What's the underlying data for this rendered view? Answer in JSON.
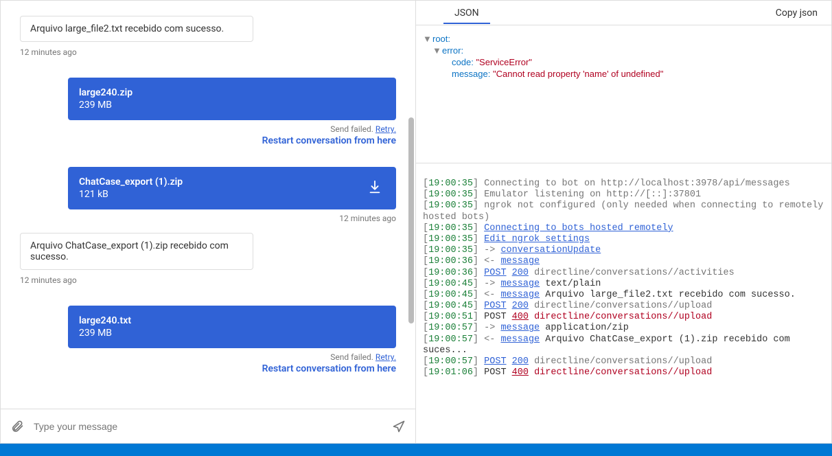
{
  "chat": {
    "messages": [
      {
        "from": "bot",
        "text": "Arquivo large_file2.txt recebido com sucesso.",
        "timestamp": "12 minutes ago"
      },
      {
        "from": "user",
        "attachment_name": "large240.zip",
        "attachment_size": "239 MB",
        "send_failed_label": "Send failed.",
        "retry_label": "Retry.",
        "restart_label": "Restart conversation from here"
      },
      {
        "from": "user",
        "attachment_name": "ChatCase_export (1).zip",
        "attachment_size": "121 kB",
        "has_download": true,
        "timestamp": "12 minutes ago"
      },
      {
        "from": "bot",
        "text": "Arquivo ChatCase_export (1).zip recebido com sucesso.",
        "timestamp": "12 minutes ago"
      },
      {
        "from": "user",
        "attachment_name": "large240.txt",
        "attachment_size": "239 MB",
        "send_failed_label": "Send failed.",
        "retry_label": "Retry.",
        "restart_label": "Restart conversation from here"
      }
    ],
    "composer_placeholder": "Type your message"
  },
  "right": {
    "tab_json_label": "JSON",
    "copy_json_label": "Copy json",
    "json_tree": {
      "root_label": "root:",
      "error_label": "error:",
      "code_label": "code:",
      "code_value": "\"ServiceError\"",
      "message_label": "message:",
      "message_value": "\"Cannot read property 'name' of undefined\""
    },
    "log": [
      {
        "ts": "19:00:35",
        "text": "Connecting to bot on http://localhost:3978/api/messages",
        "style": "dim"
      },
      {
        "ts": "19:00:35",
        "text": "Emulator listening on http://[::]:37801",
        "style": "dim"
      },
      {
        "ts": "19:00:35",
        "text": "ngrok not configured (only needed when connecting to remotely hosted bots)",
        "style": "dim"
      },
      {
        "ts": "19:00:35",
        "link": "Connecting to bots hosted remotely"
      },
      {
        "ts": "19:00:35",
        "link": "Edit ngrok settings"
      },
      {
        "ts": "19:00:35",
        "arrow": "->",
        "link": "conversationUpdate"
      },
      {
        "ts": "19:00:36",
        "arrow": "<-",
        "link": "message"
      },
      {
        "ts": "19:00:36",
        "method": "POST",
        "code": "200",
        "code_ok": true,
        "path": "directline/conversations/<conversationId>/activities",
        "path_style": "dim"
      },
      {
        "ts": "19:00:45",
        "arrow": "->",
        "link": "message",
        "suffix": "text/plain"
      },
      {
        "ts": "19:00:45",
        "arrow": "<-",
        "link": "message",
        "suffix": "Arquivo large_file2.txt recebido com sucesso."
      },
      {
        "ts": "19:00:45",
        "method": "POST",
        "code": "200",
        "code_ok": true,
        "path": "directline/conversations/<conversationId>/upload",
        "path_style": "dim"
      },
      {
        "ts": "19:00:51",
        "method": "POST",
        "code": "400",
        "code_ok": false,
        "path": "directline/conversations/<conversationId>/upload",
        "path_style": "err"
      },
      {
        "ts": "19:00:57",
        "arrow": "->",
        "link": "message",
        "suffix": "application/zip"
      },
      {
        "ts": "19:00:57",
        "arrow": "<-",
        "link": "message",
        "suffix": "Arquivo ChatCase_export (1).zip recebido com suces..."
      },
      {
        "ts": "19:00:57",
        "method": "POST",
        "code": "200",
        "code_ok": true,
        "path": "directline/conversations/<conversationId>/upload",
        "path_style": "dim"
      },
      {
        "ts": "19:01:06",
        "method": "POST",
        "code": "400",
        "code_ok": false,
        "path": "directline/conversations/<conversationId>/upload",
        "path_style": "err"
      }
    ]
  }
}
